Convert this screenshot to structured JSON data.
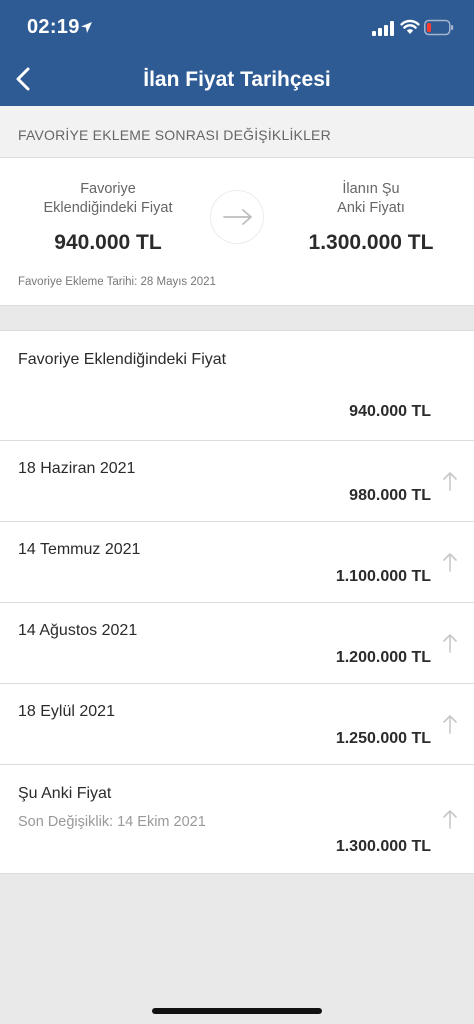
{
  "status_bar": {
    "time": "02:19"
  },
  "nav": {
    "title": "İlan Fiyat Tarihçesi"
  },
  "section": {
    "header": "FAVORİYE EKLEME SONRASI DEĞİŞİKLİKLER"
  },
  "summary": {
    "left_label_line1": "Favoriye",
    "left_label_line2": "Eklendiğindeki Fiyat",
    "left_value": "940.000 TL",
    "right_label_line1": "İlanın Şu",
    "right_label_line2": "Anki Fiyatı",
    "right_value": "1.300.000 TL",
    "date": "Favoriye Ekleme Tarihi: 28 Mayıs 2021"
  },
  "history": [
    {
      "label": "Favoriye Eklendiğindeki Fiyat",
      "value": "940.000 TL"
    },
    {
      "label": "18 Haziran 2021",
      "value": "980.000 TL",
      "trend": "up"
    },
    {
      "label": "14 Temmuz 2021",
      "value": "1.100.000 TL",
      "trend": "up"
    },
    {
      "label": "14 Ağustos 2021",
      "value": "1.200.000 TL",
      "trend": "up"
    },
    {
      "label": "18 Eylül 2021",
      "value": "1.250.000 TL",
      "trend": "up"
    },
    {
      "label": "Şu Anki Fiyat",
      "sub": "Son Değişiklik: 14 Ekim 2021",
      "value": "1.300.000 TL",
      "trend": "up"
    }
  ],
  "colors": {
    "header_bg": "#2f5b94",
    "page_bg": "#e9e9e9",
    "trend_icon": "#c8c8c8"
  }
}
